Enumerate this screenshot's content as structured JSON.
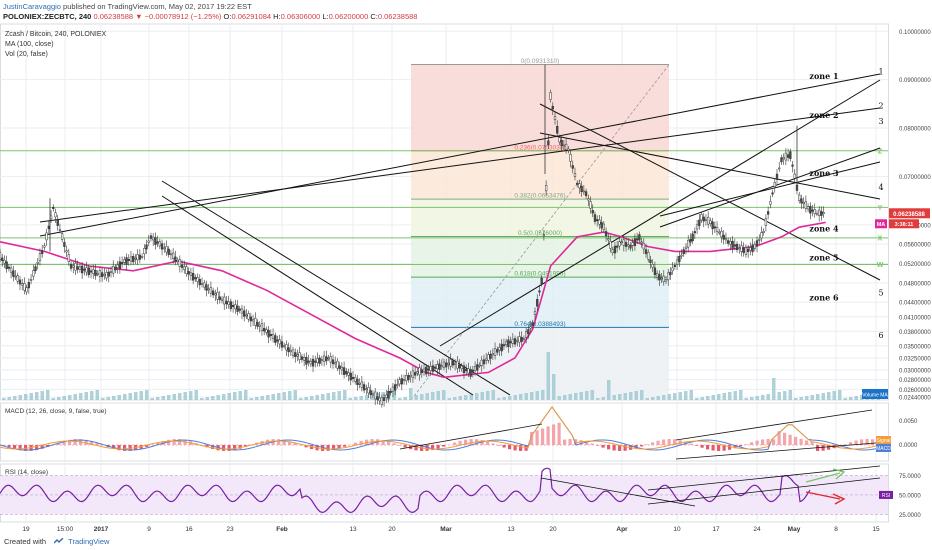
{
  "header": {
    "author": "JustinCaravaggio",
    "published": " published on TradingView.com, May 02, 2017 19:22 EST",
    "symbol": "POLONIEX:ZECBTC, 240",
    "last_price": "0.06238588",
    "change": "▼ −0.00078912 (−1.25%)",
    "open_label": "O:",
    "open": "0.06291084",
    "high_label": "H:",
    "high": "0.06306000",
    "low_label": "L:",
    "low": "0.06200000",
    "close_label": "C:",
    "close": "0.06238588"
  },
  "legend": {
    "title": "Zcash / Bitcoin, 240, POLONIEX",
    "ma": "MA (100, close)",
    "vol": "Vol (20, false)"
  },
  "footer": {
    "created": "Created with",
    "brand": "TradingView"
  },
  "colors": {
    "up": "#4a4a4a",
    "down": "#333333",
    "ma": "#e0289a",
    "grid": "#e9eef2",
    "fib_line": "#27a",
    "rsi": "#7a1fa2",
    "macd_line": "#4d7fd6",
    "signal_line": "#f39c3c",
    "hist_up": "#f4a5ac",
    "hist_down": "#e45a6d",
    "green": "#7cc36b",
    "red": "#e0262f"
  },
  "chart_data": [
    {
      "type": "line",
      "title": "Zcash / Bitcoin, 240, POLONIEX",
      "ylim": [
        0.0238,
        0.1015
      ],
      "y_ticks": [
        "0.11000000",
        "0.10000000",
        "0.09000000",
        "0.08000000",
        "0.07000000",
        "0.06000000",
        "0.05600000",
        "0.05200000",
        "0.04800000",
        "0.04400000",
        "0.04100000",
        "0.03800000",
        "0.03500000",
        "0.03250000",
        "0.03000000",
        "0.02800000",
        "0.02600000",
        "0.02440000"
      ],
      "x_ticks": [
        "19",
        "15:00",
        "2017",
        "9",
        "16",
        "23",
        "Feb",
        "13",
        "20",
        "Mar",
        "13",
        "20",
        "Apr",
        "10",
        "17",
        "24",
        "May",
        "8",
        "15"
      ],
      "series": [
        {
          "name": "ZECBTC",
          "x": [
            0,
            0.03,
            0.05,
            0.06,
            0.08,
            0.1,
            0.12,
            0.14,
            0.16,
            0.17,
            0.19,
            0.21,
            0.23,
            0.25,
            0.27,
            0.29,
            0.31,
            0.33,
            0.35,
            0.37,
            0.39,
            0.41,
            0.43,
            0.45,
            0.47,
            0.49,
            0.51,
            0.53,
            0.55,
            0.57,
            0.59,
            0.6,
            0.61,
            0.62,
            0.63,
            0.64,
            0.65,
            0.66,
            0.67,
            0.68,
            0.69,
            0.7,
            0.71,
            0.72,
            0.73,
            0.74,
            0.75,
            0.76,
            0.77,
            0.78,
            0.79,
            0.8,
            0.81,
            0.82,
            0.83,
            0.84,
            0.85,
            0.86,
            0.87,
            0.88,
            0.89,
            0.9,
            0.91,
            0.92,
            0.93
          ],
          "values": [
            0.0535,
            0.0465,
            0.0555,
            0.0635,
            0.0515,
            0.0505,
            0.0495,
            0.0525,
            0.0535,
            0.0575,
            0.0545,
            0.0505,
            0.0475,
            0.0445,
            0.0425,
            0.0395,
            0.0365,
            0.0335,
            0.0315,
            0.0325,
            0.0295,
            0.0265,
            0.0235,
            0.0275,
            0.0295,
            0.0305,
            0.0315,
            0.0295,
            0.0325,
            0.0355,
            0.0365,
            0.0395,
            0.0485,
            0.0865,
            0.0775,
            0.0755,
            0.0685,
            0.0665,
            0.0615,
            0.0595,
            0.0545,
            0.0565,
            0.0555,
            0.0575,
            0.0535,
            0.0495,
            0.0485,
            0.0515,
            0.0545,
            0.0575,
            0.0615,
            0.0605,
            0.0585,
            0.0565,
            0.0555,
            0.0545,
            0.0555,
            0.0585,
            0.0665,
            0.0735,
            0.0745,
            0.0655,
            0.0635,
            0.0624,
            0.0624
          ]
        },
        {
          "name": "MA (100, close)",
          "x": [
            0,
            0.05,
            0.1,
            0.15,
            0.2,
            0.25,
            0.3,
            0.35,
            0.4,
            0.45,
            0.48,
            0.5,
            0.55,
            0.58,
            0.6,
            0.62,
            0.65,
            0.68,
            0.7,
            0.73,
            0.76,
            0.8,
            0.85,
            0.88,
            0.9,
            0.93
          ],
          "values": [
            0.0565,
            0.0545,
            0.0515,
            0.0505,
            0.0525,
            0.0505,
            0.0465,
            0.0415,
            0.0365,
            0.0325,
            0.0295,
            0.0285,
            0.0295,
            0.0325,
            0.0385,
            0.0515,
            0.0575,
            0.0585,
            0.0575,
            0.0555,
            0.0545,
            0.0545,
            0.0555,
            0.0575,
            0.0595,
            0.0605
          ]
        }
      ],
      "fib_levels": [
        {
          "label": "0(0.0931310)",
          "value": 0.09313
        },
        {
          "label": "0.236(0.0753038)",
          "value": 0.0753
        },
        {
          "label": "0.382(0.0653476)",
          "value": 0.0653
        },
        {
          "label": "0.5(0.0576000)",
          "value": 0.0576
        },
        {
          "label": "0.618(0.0491995)",
          "value": 0.0492
        },
        {
          "label": "0.764(0.0388493)",
          "value": 0.0388
        }
      ],
      "zone_labels": [
        "zone 1",
        "zone 2",
        "zone 3",
        "zone 4",
        "zone 5",
        "zone 6"
      ],
      "line_numbers": [
        "1",
        "2",
        "3",
        "4",
        "5",
        "6"
      ],
      "level_letters": [
        "Z",
        "Y",
        "X",
        "W"
      ],
      "price_tags": {
        "last": "0.06238588",
        "ma": "MA",
        "timer": "3:38:11"
      },
      "volume_label": "Volume MA"
    },
    {
      "type": "line",
      "title": "MACD (12, 26, close, 9, false, true)",
      "y_ticks": [
        "0.0050",
        "0.0000"
      ],
      "series": [
        {
          "name": "MACD"
        },
        {
          "name": "Signal"
        }
      ],
      "tags": {
        "signal": "Signal",
        "macd": "MACD"
      }
    },
    {
      "type": "line",
      "title": "RSI (14, close)",
      "ylim": [
        15,
        90
      ],
      "y_ticks": [
        "75.0000",
        "50.0000",
        "25.0000"
      ],
      "series": [
        {
          "name": "RSI"
        }
      ],
      "tag": "RSI"
    }
  ]
}
